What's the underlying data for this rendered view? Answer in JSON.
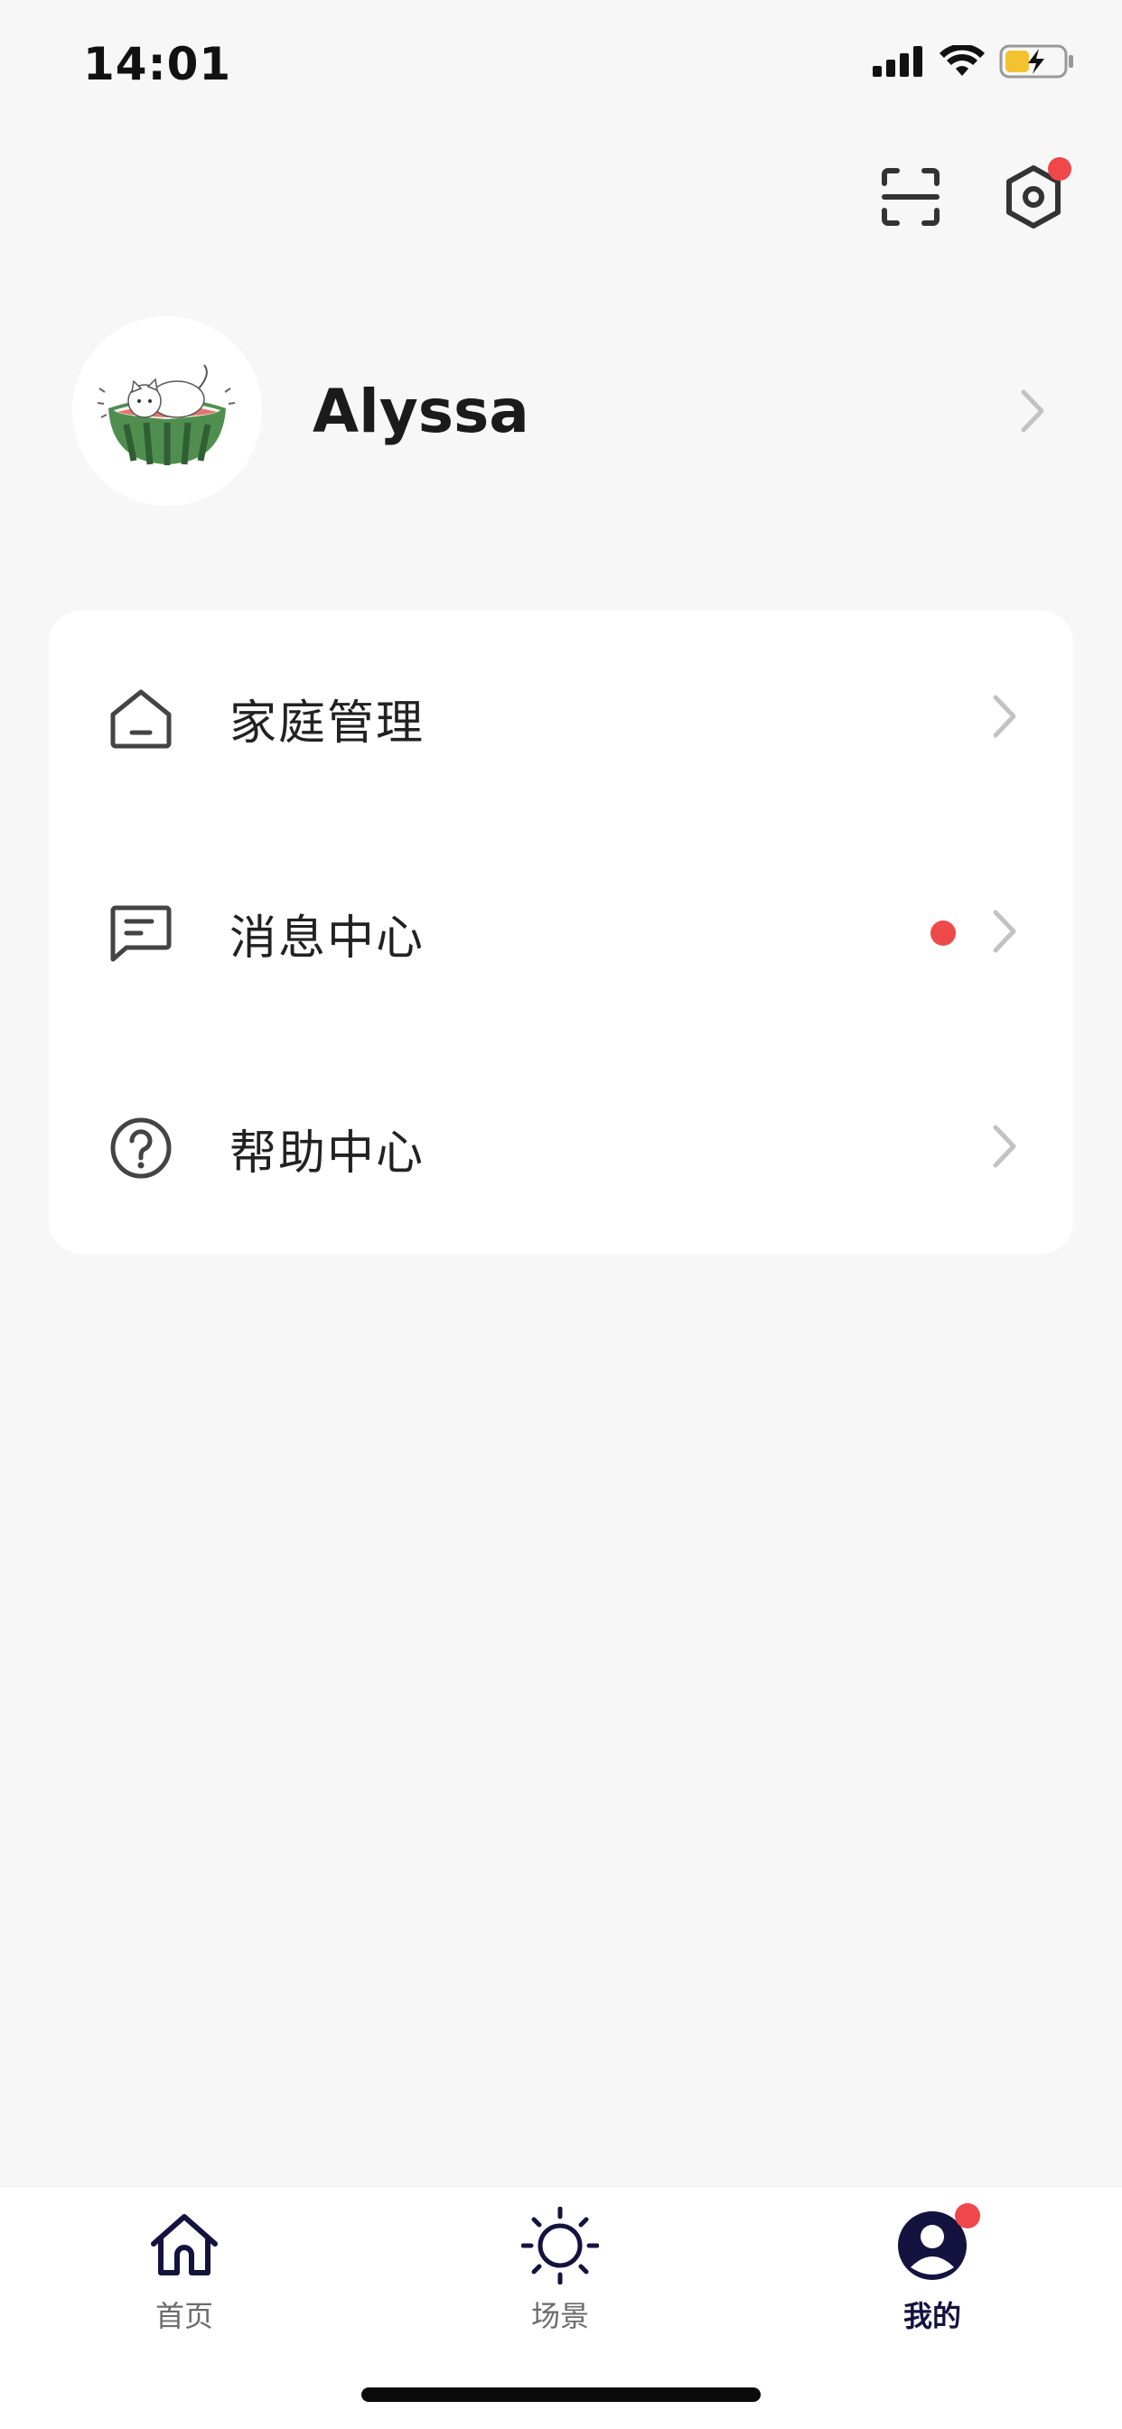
{
  "status_bar": {
    "time": "14:01",
    "icons": [
      "signal-icon",
      "wifi-icon",
      "battery-charging-icon"
    ]
  },
  "header": {
    "actions": [
      {
        "name": "scan-icon"
      },
      {
        "name": "settings-icon",
        "badge": true
      }
    ]
  },
  "profile": {
    "name": "Alyssa",
    "avatar": "avatar-cat-watermelon"
  },
  "menu": {
    "items": [
      {
        "label": "家庭管理",
        "icon": "home-icon",
        "badge": false
      },
      {
        "label": "消息中心",
        "icon": "message-icon",
        "badge": true
      },
      {
        "label": "帮助中心",
        "icon": "help-icon",
        "badge": false
      }
    ]
  },
  "tab_bar": {
    "tabs": [
      {
        "label": "首页",
        "icon": "home-outline-icon",
        "active": false
      },
      {
        "label": "场景",
        "icon": "sun-icon",
        "active": false
      },
      {
        "label": "我的",
        "icon": "user-icon",
        "active": true,
        "badge": true
      }
    ]
  },
  "colors": {
    "accent": "#14133f",
    "badge": "#f0474b",
    "background": "#f7f7f7"
  }
}
